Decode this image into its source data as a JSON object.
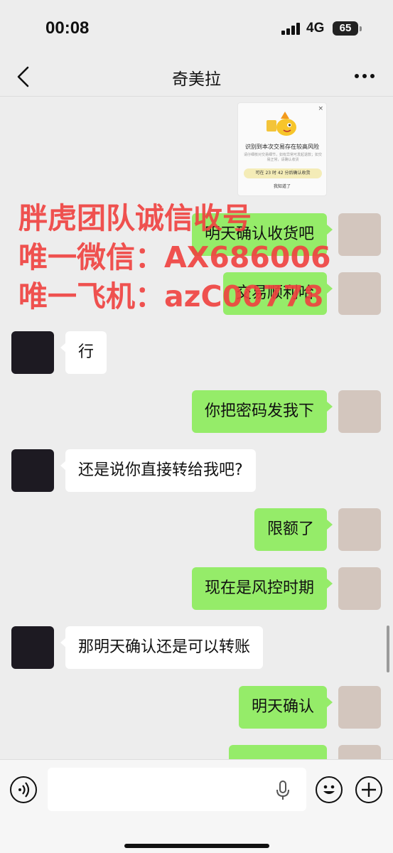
{
  "status_bar": {
    "time": "00:08",
    "network": "4G",
    "battery": "65"
  },
  "nav": {
    "title": "奇美拉",
    "back_icon": "chevron-left-icon",
    "more_icon": "ellipsis-icon"
  },
  "risk_card": {
    "title": "识别到本次交易存在较高风险",
    "description": "请仔细核对交易细节，如有异常可发起退款；如交易正常，请确认收货",
    "pill": "可在 23 时 42 分后确认收货",
    "link": "我知道了",
    "close": "×"
  },
  "overlay": {
    "line1": "胖虎团队诚信收号",
    "line2": "唯一微信：AX686006",
    "line3": "唯一飞机：azC00778"
  },
  "messages": [
    {
      "side": "right",
      "text": "明天确认收货吧"
    },
    {
      "side": "right",
      "text": "交易顺利哈"
    },
    {
      "side": "left",
      "text": "行"
    },
    {
      "side": "right",
      "text": "你把密码发我下"
    },
    {
      "side": "left",
      "text": "还是说你直接转给我吧?"
    },
    {
      "side": "right",
      "text": "限额了"
    },
    {
      "side": "right",
      "text": "现在是风控时期"
    },
    {
      "side": "left",
      "text": "那明天确认还是可以转账"
    },
    {
      "side": "right",
      "text": "明天确认"
    },
    {
      "side": "right",
      "text": ""
    }
  ],
  "input_bar": {
    "voice_icon": "voice-mode-icon",
    "mic_icon": "microphone-icon",
    "emoji_icon": "emoji-icon",
    "plus_icon": "plus-icon",
    "text_value": ""
  },
  "colors": {
    "bubble_self": "#95ec69",
    "bubble_other": "#ffffff",
    "background": "#ededed",
    "watermark": "#f0413f"
  }
}
